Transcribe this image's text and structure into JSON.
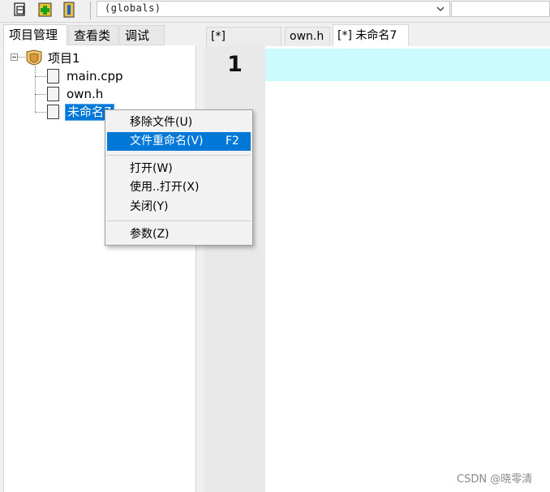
{
  "toolbar": {
    "buttons": [
      {
        "icon": "new-file-icon"
      },
      {
        "icon": "add-file-icon"
      },
      {
        "icon": "insert-icon"
      }
    ],
    "scope_combo": {
      "value": "(globals)",
      "arrow_icon": "chevron-down-icon"
    }
  },
  "left_panel": {
    "tabs": [
      {
        "label": "项目管理",
        "active": true
      },
      {
        "label": "查看类",
        "active": false
      },
      {
        "label": "调试",
        "active": false
      }
    ],
    "tree": {
      "project": {
        "label": "项目1",
        "icon": "project-folder-icon",
        "expanded": true
      },
      "files": [
        {
          "label": "main.cpp",
          "icon": "file-icon",
          "selected": false
        },
        {
          "label": "own.h",
          "icon": "file-icon",
          "selected": false
        },
        {
          "label": "未命名7",
          "icon": "file-icon",
          "selected": true
        }
      ]
    }
  },
  "editor": {
    "tabs": [
      {
        "label": "[*] main.cpp",
        "active": false
      },
      {
        "label": "own.h",
        "active": false
      },
      {
        "label": "[*] 未命名7",
        "active": true
      }
    ],
    "line_numbers": [
      "1"
    ],
    "current_line_color": "#ccfbff"
  },
  "context_menu": {
    "items": [
      {
        "label": "移除文件(U)",
        "shortcut": "",
        "highlighted": false
      },
      {
        "label": "文件重命名(V)",
        "shortcut": "F2",
        "highlighted": true
      },
      {
        "label": "打开(W)",
        "shortcut": "",
        "highlighted": false
      },
      {
        "label": "使用..打开(X)",
        "shortcut": "",
        "highlighted": false
      },
      {
        "label": "关闭(Y)",
        "shortcut": "",
        "highlighted": false
      },
      {
        "label": "参数(Z)",
        "shortcut": "",
        "highlighted": false
      }
    ]
  },
  "watermark": "CSDN @晓零清",
  "colors": {
    "selection": "#0078d7",
    "current_line": "#ccfbff",
    "gutter": "#e9e9e9"
  }
}
